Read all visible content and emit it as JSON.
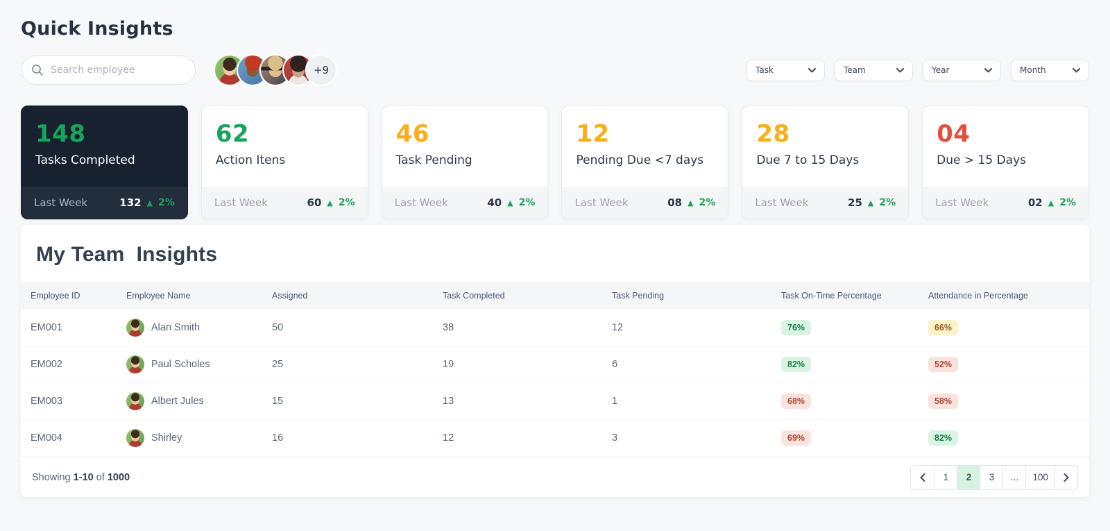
{
  "page": {
    "title": "Quick Insights"
  },
  "header": {
    "search_placeholder": "Search employee",
    "avatar_overflow": "+9",
    "filters": [
      {
        "label": "Task"
      },
      {
        "label": "Team"
      },
      {
        "label": "Year"
      },
      {
        "label": "Month"
      }
    ]
  },
  "stat_cards": [
    {
      "value": "148",
      "label": "Tasks Completed",
      "tone": "green",
      "theme": "dark",
      "last_week_label": "Last Week",
      "last_week_value": "132",
      "trend": "2%"
    },
    {
      "value": "62",
      "label": "Action Itens",
      "tone": "green",
      "theme": "light",
      "last_week_label": "Last Week",
      "last_week_value": "60",
      "trend": "2%"
    },
    {
      "value": "46",
      "label": "Task Pending",
      "tone": "amber",
      "theme": "light",
      "last_week_label": "Last Week",
      "last_week_value": "40",
      "trend": "2%"
    },
    {
      "value": "12",
      "label": "Pending Due <7 days",
      "tone": "amber",
      "theme": "light",
      "last_week_label": "Last Week",
      "last_week_value": "08",
      "trend": "2%"
    },
    {
      "value": "28",
      "label": "Due 7 to 15 Days",
      "tone": "amber",
      "theme": "light",
      "last_week_label": "Last Week",
      "last_week_value": "25",
      "trend": "2%"
    },
    {
      "value": "04",
      "label": "Due > 15 Days",
      "tone": "red",
      "theme": "light",
      "last_week_label": "Last Week",
      "last_week_value": "02",
      "trend": "2%"
    }
  ],
  "team_insights": {
    "title": "My Team  Insights",
    "columns": [
      "Employee ID",
      "Employee Name",
      "Assigned",
      "Task Completed",
      "Task Pending",
      "Task On-Time Percentage",
      "Attendance in Percentage"
    ],
    "rows": [
      {
        "id": "EM001",
        "name": "Alan Smith",
        "assigned": "50",
        "completed": "38",
        "pending": "12",
        "on_time": "76%",
        "on_time_status": "green",
        "attendance": "66%",
        "attendance_status": "yellow"
      },
      {
        "id": "EM002",
        "name": "Paul Scholes",
        "assigned": "25",
        "completed": "19",
        "pending": "6",
        "on_time": "82%",
        "on_time_status": "green",
        "attendance": "52%",
        "attendance_status": "red"
      },
      {
        "id": "EM003",
        "name": "Albert Jules",
        "assigned": "15",
        "completed": "13",
        "pending": "1",
        "on_time": "68%",
        "on_time_status": "red",
        "attendance": "58%",
        "attendance_status": "red"
      },
      {
        "id": "EM004",
        "name": "Shirley",
        "assigned": "16",
        "completed": "12",
        "pending": "3",
        "on_time": "69%",
        "on_time_status": "red",
        "attendance": "82%",
        "attendance_status": "green"
      }
    ],
    "footer": {
      "showing_prefix": "Showing",
      "range": "1-10",
      "of_label": "of",
      "total": "1000"
    },
    "pagination": {
      "pages": [
        {
          "label": "1",
          "active": "false"
        },
        {
          "label": "2",
          "active": "true"
        },
        {
          "label": "3",
          "active": "false"
        },
        {
          "label": "...",
          "active": "false"
        },
        {
          "label": "100",
          "active": "false"
        }
      ]
    }
  },
  "colors": {
    "accent_green": "#19a45b",
    "accent_amber": "#fbae17",
    "accent_red": "#e2503c",
    "dark_card_bg": "#18212f",
    "badge_green_bg": "#d9f4e2",
    "badge_yellow_bg": "#fdf3c8",
    "badge_red_bg": "#fbe3dd",
    "pagination_active_bg": "#d7f2de"
  }
}
